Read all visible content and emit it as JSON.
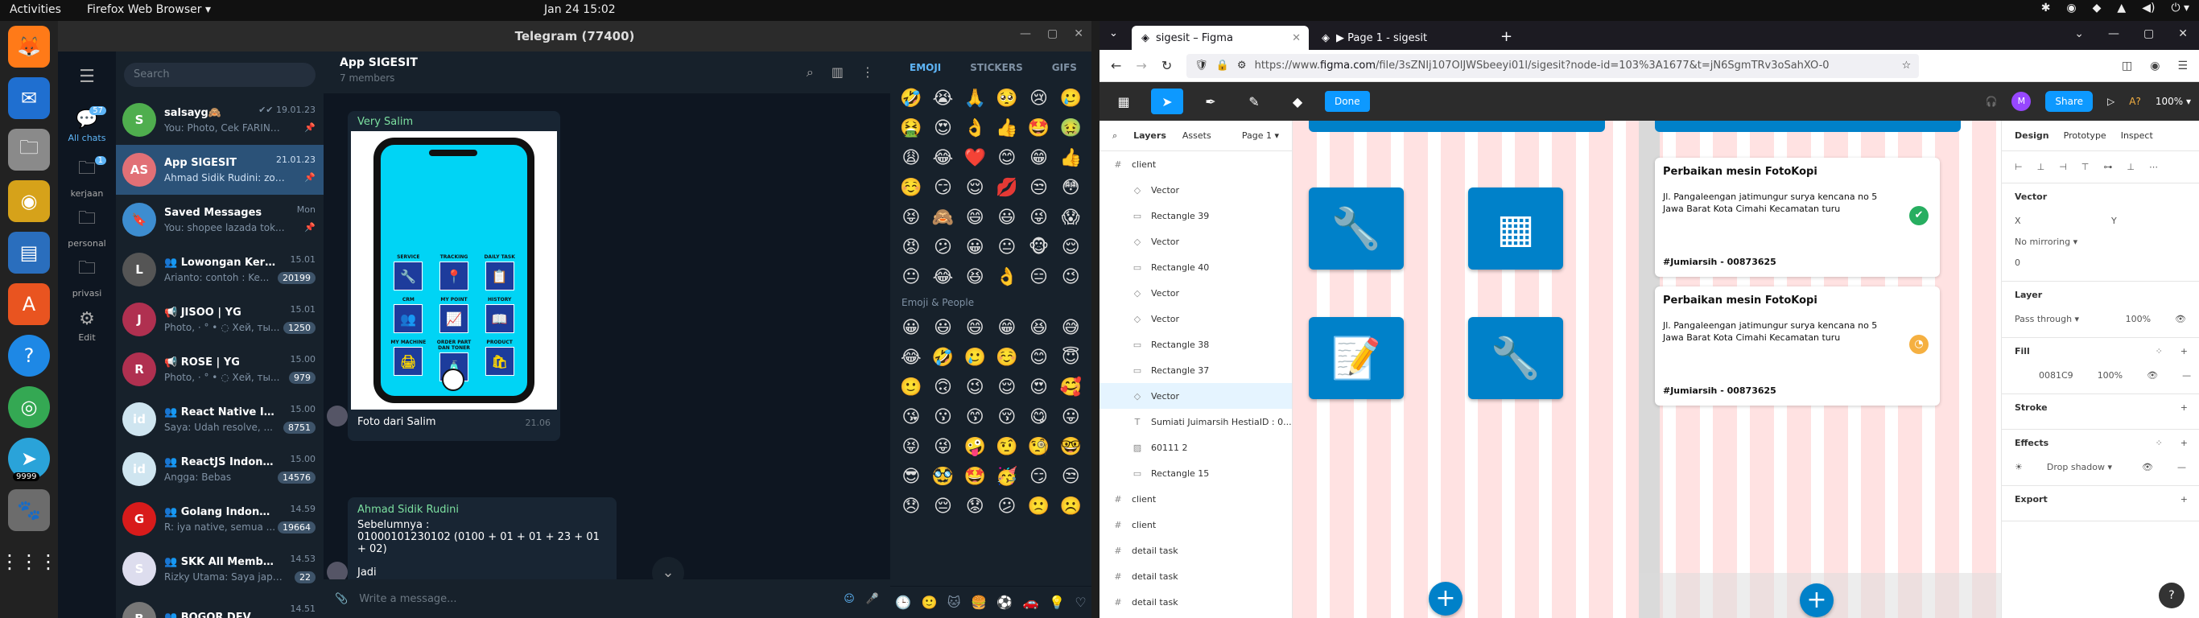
{
  "topbar": {
    "activities": "Activities",
    "app": "Firefox Web Browser ▾",
    "clock": "Jan 24  15:02",
    "tray": [
      "✱",
      "◉",
      "◆",
      "▲",
      "◀)",
      "⏻ ▾"
    ]
  },
  "dock": {
    "items": [
      "firefox-icon",
      "thunderbird-icon",
      "files-icon",
      "rhythmbox-icon",
      "writer-icon",
      "software-icon",
      "help-icon",
      "chrome-icon",
      "telegram-icon",
      "gimp-icon",
      "apps-grid-icon"
    ],
    "badge": "9999"
  },
  "telegram": {
    "window_title": "Telegram (77400)",
    "folders": [
      {
        "label": "All chats",
        "badge": "57"
      },
      {
        "label": "kerjaan",
        "badge": "1"
      },
      {
        "label": "personal",
        "badge": ""
      },
      {
        "label": "privasi",
        "badge": ""
      },
      {
        "label": "Edit",
        "badge": ""
      }
    ],
    "search_placeholder": "Search",
    "chats": [
      {
        "initials": "S",
        "color": "#4fae4e",
        "name": "salsayg🙈",
        "msg": "You: Photo, Cek FARINA ...",
        "time": "✔✔ 19.01.23",
        "badge": "",
        "pinned": "📌"
      },
      {
        "initials": "AS",
        "color": "#e17076",
        "name": "App SIGESIT",
        "msg": "Ahmad Sidik Rudini: zoo...",
        "time": "21.01.23",
        "badge": "",
        "pinned": "📌"
      },
      {
        "initials": "🔖",
        "color": "#3d8dd0",
        "name": "Saved Messages",
        "msg": "You: shopee lazada tok...",
        "time": "Mon",
        "badge": "",
        "pinned": "📌"
      },
      {
        "initials": "L",
        "color": "#555",
        "name": "👥 Lowongan Kerja IT",
        "msg": "Arianto: contoh : Ke...",
        "time": "15.01",
        "badge": "20199",
        "pinned": ""
      },
      {
        "initials": "J",
        "color": "#b03050",
        "name": "📢 JISOO | YG",
        "msg": "Photo, · ° • ◌ Хей, ты...",
        "time": "15.01",
        "badge": "1250",
        "pinned": ""
      },
      {
        "initials": "R",
        "color": "#b03050",
        "name": "📢 ROSÉ | YG",
        "msg": "Photo, · ° • ◌ Хей, ты...",
        "time": "15.00",
        "badge": "979",
        "pinned": ""
      },
      {
        "initials": "id",
        "color": "#cfe5f0",
        "name": "👥 React Native Indo...",
        "msg": "Saya: Udah resolve, ...",
        "time": "15.00",
        "badge": "8751",
        "pinned": ""
      },
      {
        "initials": "id",
        "color": "#cfe5f0",
        "name": "👥 ReactJS Indonesia",
        "msg": "Angga: Bebas",
        "time": "15.00",
        "badge": "14576",
        "pinned": ""
      },
      {
        "initials": "G",
        "color": "#d81b1b",
        "name": "👥 Golang Indonesia...",
        "msg": "R: iya native, semua ...",
        "time": "14.59",
        "badge": "19664",
        "pinned": ""
      },
      {
        "initials": "S",
        "color": "#dde",
        "name": "👥 SKK All Members",
        "msg": "Rizky Utama: Saya japri...",
        "time": "14.53",
        "badge": "22",
        "pinned": ""
      },
      {
        "initials": "B",
        "color": "#777",
        "name": "👥 BOGOR DEV",
        "msg": "",
        "time": "14.51",
        "badge": "",
        "pinned": ""
      }
    ],
    "chat": {
      "title": "App SIGESIT",
      "subtitle": "7 members",
      "msg1_sender": "Very Salim",
      "phone_labels": [
        "SERVICE",
        "TRACKING",
        "DAILY TASK",
        "CRM",
        "MY POINT",
        "HISTORY",
        "MY MACHINE",
        "ORDER PART DAN TONER",
        "PRODUCT"
      ],
      "phone_icons": [
        "🔧",
        "📍",
        "📋",
        "👥",
        "📈",
        "📖",
        "🖨",
        "🧴",
        "🛍"
      ],
      "msg1_caption": "Foto dari Salim",
      "msg1_time": "21.06",
      "msg2_sender": "Ahmad Sidik Rudini",
      "msg2_line1": "Sebelumnya :",
      "msg2_line2": "01000101230102 (0100 + 01 + 01 + 23 + 01 + 02)",
      "msg2_line3": "Jadi",
      "input_placeholder": "Write a message..."
    },
    "emoji": {
      "tabs": [
        "EMOJI",
        "STICKERS",
        "GIFS"
      ],
      "recent": [
        "🤣",
        "😭",
        "🙏",
        "🥺",
        "😢",
        "🥲",
        "🤮",
        "😍",
        "👌",
        "👍",
        "🤩",
        "🤢",
        "😩",
        "😂",
        "❤️",
        "😊",
        "😁",
        "👍",
        "☺️",
        "😏",
        "😌",
        "💋",
        "😒",
        "😳",
        "😝",
        "🙈",
        "😄",
        "😃",
        "😜",
        "😱",
        "😡",
        "😕",
        "😀",
        "😐",
        "🐵",
        "😌",
        "😐",
        "😂",
        "😆",
        "👌",
        "😑",
        "😉"
      ],
      "section_label": "Emoji & People",
      "people": [
        "😀",
        "😃",
        "😄",
        "😁",
        "😆",
        "😅",
        "😂",
        "🤣",
        "🥲",
        "☺️",
        "😊",
        "😇",
        "🙂",
        "🙃",
        "😉",
        "😌",
        "😍",
        "🥰",
        "😘",
        "😗",
        "😙",
        "😚",
        "😋",
        "😛",
        "😝",
        "😜",
        "🤪",
        "🤨",
        "🧐",
        "🤓",
        "😎",
        "🥸",
        "🤩",
        "🥳",
        "😏",
        "😒",
        "😞",
        "😔",
        "😟",
        "😕",
        "🙁",
        "☹️"
      ],
      "footer": [
        "🕒",
        "🙂",
        "🐱",
        "🍔",
        "⚽",
        "🚗",
        "💡",
        "♡"
      ]
    }
  },
  "firefox": {
    "tabs": [
      {
        "label": "sigesit – Figma",
        "icon": "figma-icon",
        "active": true
      },
      {
        "label": "▶ Page 1 - sigesit",
        "icon": "figma-icon",
        "active": false
      }
    ],
    "url_prefix": "https://www.",
    "url_domain": "figma.com",
    "url_path": "/file/3sZNIj107OlJWSbeeyi01l/sigesit?node-id=103%3A1677&t=jN6SgmTRv3oSahXO-0"
  },
  "figma": {
    "done": "Done",
    "share": "Share",
    "avatar": "M",
    "zoom": "100% ▾",
    "a_label": "A?",
    "layers_tabs": [
      "Layers",
      "Assets"
    ],
    "page": "Page 1 ▾",
    "layers": [
      {
        "name": "client",
        "type": "#",
        "child": false,
        "sel": false
      },
      {
        "name": "Vector",
        "type": "◇",
        "child": true,
        "sel": false
      },
      {
        "name": "Rectangle 39",
        "type": "▭",
        "child": true,
        "sel": false
      },
      {
        "name": "Vector",
        "type": "◇",
        "child": true,
        "sel": false
      },
      {
        "name": "Rectangle 40",
        "type": "▭",
        "child": true,
        "sel": false
      },
      {
        "name": "Vector",
        "type": "◇",
        "child": true,
        "sel": false
      },
      {
        "name": "Vector",
        "type": "◇",
        "child": true,
        "sel": false
      },
      {
        "name": "Rectangle 38",
        "type": "▭",
        "child": true,
        "sel": false
      },
      {
        "name": "Rectangle 37",
        "type": "▭",
        "child": true,
        "sel": false
      },
      {
        "name": "Vector",
        "type": "◇",
        "child": true,
        "sel": true
      },
      {
        "name": "Sumiati Juimarsih HestiaID : 0...",
        "type": "T",
        "child": true,
        "sel": false
      },
      {
        "name": "60111 2",
        "type": "▨",
        "child": true,
        "sel": false
      },
      {
        "name": "Rectangle 15",
        "type": "▭",
        "child": true,
        "sel": false
      },
      {
        "name": "client",
        "type": "#",
        "child": false,
        "sel": false
      },
      {
        "name": "client",
        "type": "#",
        "child": false,
        "sel": false
      },
      {
        "name": "detail task",
        "type": "#",
        "child": false,
        "sel": false
      },
      {
        "name": "detail task",
        "type": "#",
        "child": false,
        "sel": false
      },
      {
        "name": "detail task",
        "type": "#",
        "child": false,
        "sel": false
      }
    ],
    "tiles": [
      "🔧",
      "▦",
      "📝",
      "🔧"
    ],
    "cards": [
      {
        "title": "Perbaikan mesin FotoKopi",
        "addr": "Jl. Pangaleengan jatimungur surya kencana no 5 Jawa Barat Kota Cimahi Kecamatan turu",
        "id": "#Jumiarsih - 00873625",
        "status": "✔",
        "status_color": "#27ae60"
      },
      {
        "title": "Perbaikan mesin FotoKopi",
        "addr": "Jl. Pangaleengan jatimungur surya kencana no 5 Jawa Barat Kota Cimahi Kecamatan turu",
        "id": "#Jumiarsih - 00873625",
        "status": "◔",
        "status_color": "#f5b041"
      }
    ],
    "props": {
      "tabs": [
        "Design",
        "Prototype",
        "Inspect"
      ],
      "section_vector": "Vector",
      "x_label": "X",
      "y_label": "Y",
      "mirroring": "No mirroring ▾",
      "radius": "0",
      "layer_h": "Layer",
      "blend": "Pass through ▾",
      "opacity": "100%",
      "fill_h": "Fill",
      "fill_hex": "0081C9",
      "fill_op": "100%",
      "stroke_h": "Stroke",
      "effects_h": "Effects",
      "effect": "Drop shadow ▾",
      "export_h": "Export",
      "fill_color": "#0081C9"
    }
  }
}
